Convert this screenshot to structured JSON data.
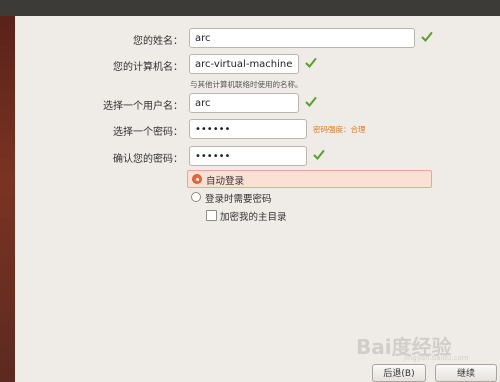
{
  "colors": {
    "accent": "#e06a3d",
    "check_green": "#5aa02c",
    "strength_orange": "#e07a1e"
  },
  "form": {
    "name": {
      "label": "您的姓名：",
      "value": "arc"
    },
    "computer": {
      "label": "您的计算机名：",
      "value": "arc-virtual-machine",
      "hint": "与其他计算机联络时使用的名称。"
    },
    "username": {
      "label": "选择一个用户名：",
      "value": "arc"
    },
    "password": {
      "label": "选择一个密码：",
      "value": "••••••",
      "strength": "密码强度：合理"
    },
    "confirm": {
      "label": "确认您的密码：",
      "value": "••••••"
    }
  },
  "options": {
    "auto_login": {
      "label": "自动登录",
      "selected": true
    },
    "require_password": {
      "label": "登录时需要密码",
      "selected": false
    },
    "encrypt_home": {
      "label": "加密我的主目录",
      "checked": false
    }
  },
  "buttons": {
    "back": "后退(B)",
    "continue": "继续"
  },
  "watermark": {
    "text": "Bai度经验",
    "url": "jingyan.baidu.com"
  }
}
